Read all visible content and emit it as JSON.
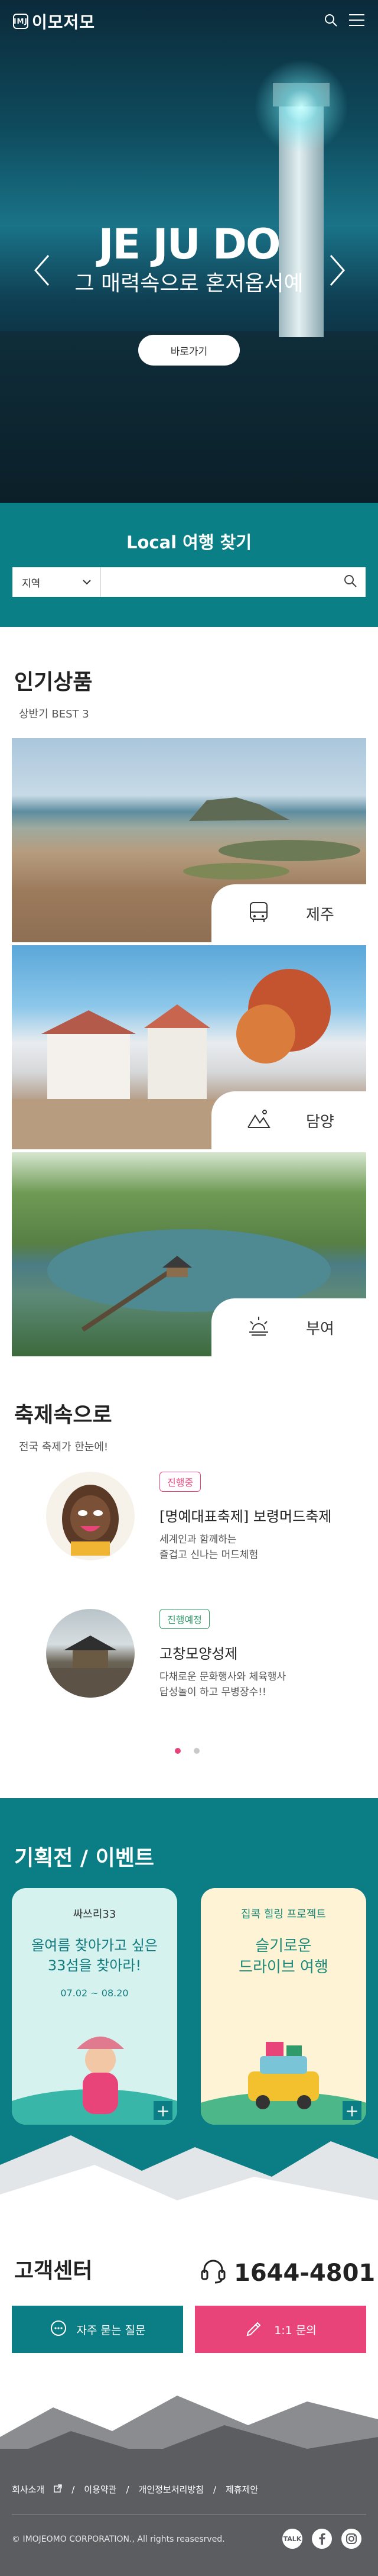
{
  "header": {
    "logo_text": "이모저모",
    "logo_mark": "IMJ",
    "icons": [
      "search-icon",
      "menu-icon"
    ]
  },
  "hero": {
    "title": "JE JU DO",
    "subtitle": "그 매력속으로 혼저옵서예",
    "button": "바로가기"
  },
  "local": {
    "title": "Local 여행 찾기",
    "select_value": "지역",
    "placeholder": "",
    "accent": "#0a7f86"
  },
  "popular": {
    "title": "인기상품",
    "subtitle": "상반기 BEST 3",
    "items": [
      {
        "label": "제주",
        "icon": "bus-icon"
      },
      {
        "label": "담양",
        "icon": "mountain-icon"
      },
      {
        "label": "부여",
        "icon": "sunrise-icon"
      }
    ]
  },
  "festival": {
    "title": "축제속으로",
    "subtitle": "전국 축제가 한눈에!",
    "items": [
      {
        "badge": "진행중",
        "badge_color": "#e8447a",
        "name": "[명예대표축제] 보령머드축제",
        "desc": [
          "세계인과 함께하는",
          "즐겁고 신나는 머드체험"
        ]
      },
      {
        "badge": "진행예정",
        "badge_color": "#2f9b6b",
        "name": "고창모양성제",
        "desc": [
          "다채로운 문화행사와 체육행사",
          "답성놀이 하고 무병장수!!"
        ]
      }
    ]
  },
  "events": {
    "title": "기획전 / 이벤트",
    "cards": [
      {
        "tag": "싸쓰리33",
        "headline": [
          "올여름 찾아가고 싶은",
          "33섬을 찾아라!"
        ],
        "date": "07.02 ~ 08.20",
        "plus": "+"
      },
      {
        "tag": "집콕 힐링 프로젝트",
        "headline": [
          "슬기로운",
          "드라이브 여행"
        ],
        "plus": "+"
      }
    ]
  },
  "support": {
    "title": "고객센터",
    "phone": "1644-4801",
    "faq": "자주 묻는 질문",
    "inquiry": "1:1 문의"
  },
  "footer": {
    "links": [
      "회사소개",
      "이용약관",
      "개인정보처리방침",
      "제휴제안"
    ],
    "separator": "/",
    "copyright": "© IMOJEOMO CORPORATION., All rights reasesrved.",
    "social": [
      "kakao-icon",
      "facebook-icon",
      "instagram-icon"
    ],
    "kakao_label": "TALK"
  }
}
